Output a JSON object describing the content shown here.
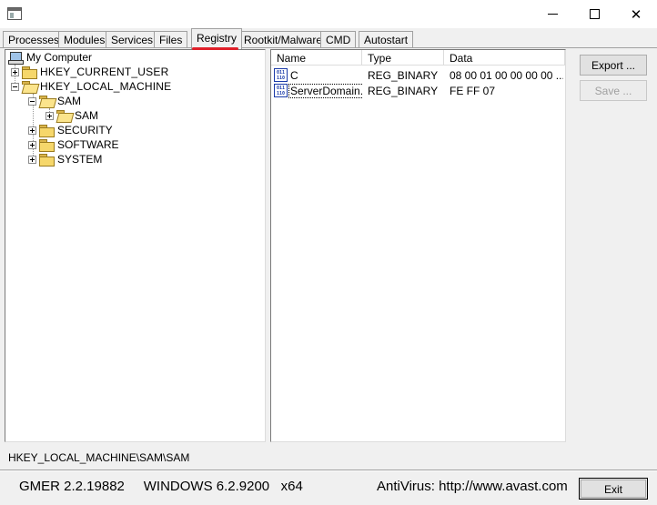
{
  "window": {
    "controls": {
      "minimize": "minimize",
      "maximize": "maximize",
      "close": "close"
    }
  },
  "tabs": [
    {
      "label": "Processes"
    },
    {
      "label": "Modules"
    },
    {
      "label": "Services"
    },
    {
      "label": "Files"
    },
    {
      "label": "Registry",
      "active": true
    },
    {
      "label": "Rootkit/Malware"
    },
    {
      "label": "CMD"
    },
    {
      "label": "Autostart"
    }
  ],
  "accent_color": "#e0202a",
  "tree": {
    "root": "My Computer",
    "hkcu": "HKEY_CURRENT_USER",
    "hklm": "HKEY_LOCAL_MACHINE",
    "sam": "SAM",
    "sam_child": "SAM",
    "security": "SECURITY",
    "software": "SOFTWARE",
    "system": "SYSTEM"
  },
  "list": {
    "columns": {
      "name": "Name",
      "type": "Type",
      "data": "Data"
    },
    "rows": [
      {
        "name": "C",
        "type": "REG_BINARY",
        "data": "08 00 01 00 00 00 00 ..."
      },
      {
        "name": "ServerDomain...",
        "type": "REG_BINARY",
        "data": "FE FF 07"
      }
    ]
  },
  "buttons": {
    "export": "Export ...",
    "save": "Save ...",
    "exit": "Exit"
  },
  "path": "HKEY_LOCAL_MACHINE\\SAM\\SAM",
  "status": {
    "version": "GMER 2.2.19882",
    "os": "WINDOWS 6.2.9200",
    "arch": "x64",
    "antivirus": "AntiVirus: http://www.avast.com"
  }
}
